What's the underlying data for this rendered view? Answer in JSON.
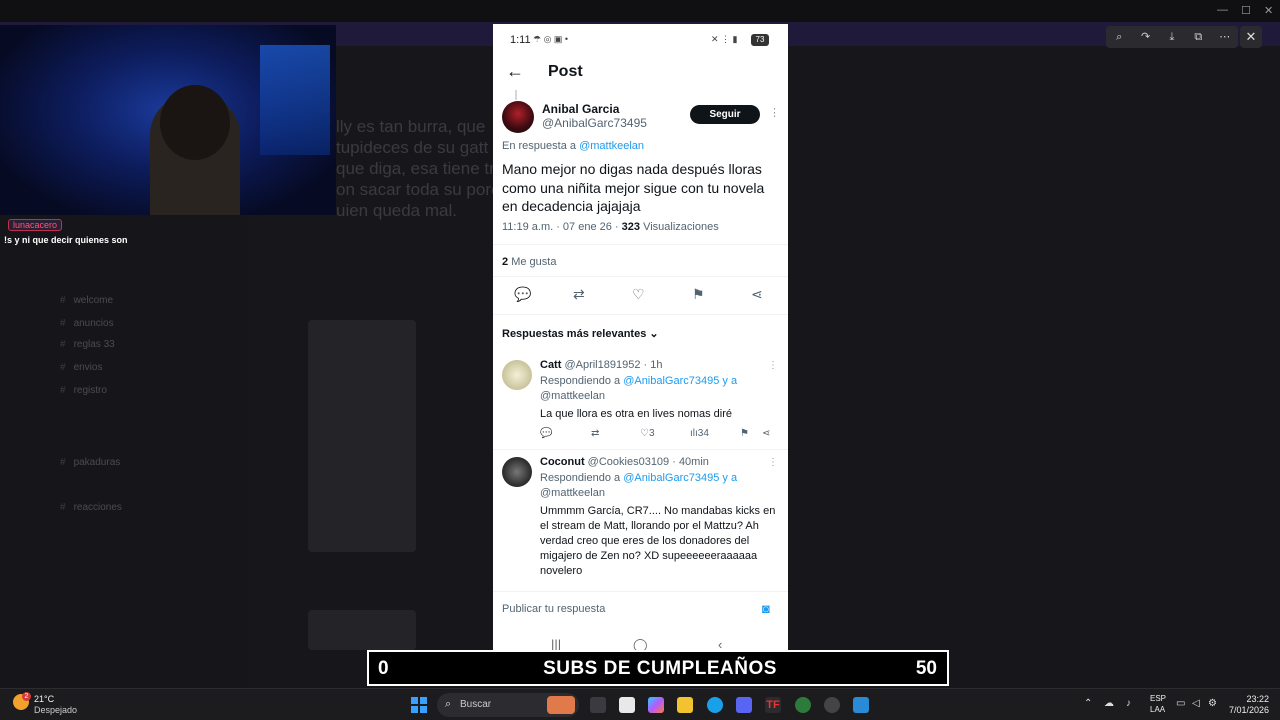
{
  "phone": {
    "status_time": "1:11",
    "battery": "73",
    "header_title": "Post",
    "author": {
      "name": "Anibal Garcia",
      "handle": "@AnibalGarc73495"
    },
    "follow_label": "Seguir",
    "reply_to_prefix": "En respuesta a",
    "reply_to_user": "@mattkeelan",
    "post_text": "Mano mejor no digas nada después lloras como una niñita mejor sigue con tu novela en decadencia jajajaja",
    "meta_time": "11:19 a.m. · 07 ene 26 ·",
    "meta_views_count": "323",
    "meta_views_label": "Visualizaciones",
    "likes_count": "2",
    "likes_label": "Me gusta",
    "sort_label": "Respuestas más relevantes",
    "replies": [
      {
        "name": "Catt",
        "handle_time": "@April1891952 · 1h",
        "replying_prefix": "Respondiendo a",
        "replying_users_line1": "@AnibalGarc73495 y a",
        "replying_users_line2": "@mattkeelan",
        "text": "La que llora es otra en lives nomas diré",
        "likes": "3",
        "views": "34"
      },
      {
        "name": "Coconut",
        "handle_time": "@Cookies03109 · 40min",
        "replying_prefix": "Respondiendo a",
        "replying_users_line1": "@AnibalGarc73495 y a",
        "replying_users_line2": "@mattkeelan",
        "text": "Ummmm García, CR7.... No mandabas kicks en el stream de Matt, llorando por el Mattzu? Ah verdad creo que eres de los donadores del migajero de Zen no? XD supeeeeeeraaaaaa novelero"
      }
    ],
    "compose_placeholder": "Publicar tu respuesta"
  },
  "stream": {
    "chat_user": "lunacacero",
    "chat_message": "!s y ni que decir quienes son",
    "subs_current": "0",
    "subs_title": "SUBS DE CUMPLEAÑOS",
    "subs_goal": "50"
  },
  "background_ghost_text": [
    "lly es tan burra, que",
    "tupideces de su gatt",
    "que diga, esa tiene tre",
    "on sacar toda su porc",
    "uien queda mal."
  ],
  "background_channels": [
    "welcome",
    "anuncios",
    "reglas 33",
    "envios",
    "registro",
    "pakaduras",
    "reacciones"
  ],
  "taskbar": {
    "temperature": "21°C",
    "weather": "Despejado",
    "weather_badge": "2",
    "search_placeholder": "Buscar",
    "lang1": "ESP",
    "lang2": "LAA",
    "time": "23:22",
    "date": "7/01/2026"
  },
  "colors": {
    "accent_link": "#1d9bf0",
    "text_primary": "#0f1419",
    "text_secondary": "#536471",
    "follow_button": "#0f1419"
  }
}
